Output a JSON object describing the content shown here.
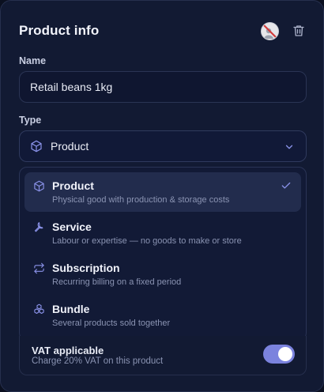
{
  "header": {
    "title": "Product info",
    "avatar_icon": "avatar-icon",
    "delete_icon": "trash-icon"
  },
  "name_field": {
    "label": "Name",
    "value": "Retail beans 1kg"
  },
  "type_field": {
    "label": "Type",
    "selected": "Product",
    "selected_icon": "box-icon"
  },
  "dropdown": {
    "options": [
      {
        "title": "Product",
        "description": "Physical good with production & storage costs",
        "icon": "box-icon",
        "selected": true
      },
      {
        "title": "Service",
        "description": "Labour or expertise — no goods to make or store",
        "icon": "wrench-icon",
        "selected": false
      },
      {
        "title": "Subscription",
        "description": "Recurring billing on a fixed period",
        "icon": "repeat-icon",
        "selected": false
      },
      {
        "title": "Bundle",
        "description": "Several products sold together",
        "icon": "bundle-icon",
        "selected": false
      }
    ]
  },
  "vat": {
    "title": "VAT applicable",
    "description": "Charge 20% VAT on this product",
    "enabled": true
  },
  "colors": {
    "accent": "#7b83de",
    "card_bg": "#121a33",
    "icon_accent": "#8b93ea"
  }
}
